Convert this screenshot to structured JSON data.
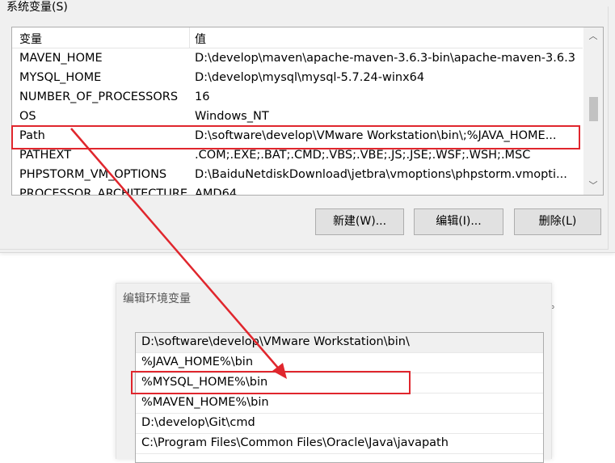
{
  "system_dialog": {
    "group_title": "系统变量(S)",
    "columns": {
      "name": "变量",
      "value": "值"
    },
    "rows": [
      {
        "name": "MAVEN_HOME",
        "value": "D:\\develop\\maven\\apache-maven-3.6.3-bin\\apache-maven-3.6.3"
      },
      {
        "name": "MYSQL_HOME",
        "value": "D:\\develop\\mysql\\mysql-5.7.24-winx64"
      },
      {
        "name": "NUMBER_OF_PROCESSORS",
        "value": "16"
      },
      {
        "name": "OS",
        "value": "Windows_NT"
      },
      {
        "name": "Path",
        "value": "D:\\software\\develop\\VMware Workstation\\bin\\;%JAVA_HOME..."
      },
      {
        "name": "PATHEXT",
        "value": ".COM;.EXE;.BAT;.CMD;.VBS;.VBE;.JS;.JSE;.WSF;.WSH;.MSC"
      },
      {
        "name": "PHPSTORM_VM_OPTIONS",
        "value": "D:\\BaiduNetdiskDownload\\jetbra\\vmoptions\\phpstorm.vmopti..."
      },
      {
        "name": "PROCESSOR_ARCHITECTURE",
        "value": "AMD64"
      }
    ],
    "buttons": {
      "new": "新建(W)...",
      "edit": "编辑(I)...",
      "delete": "删除(L)"
    },
    "scroll_up_glyph": "︿",
    "scroll_down_glyph": "﹀"
  },
  "edit_dialog": {
    "title": "编辑环境变量",
    "entries": [
      "D:\\software\\develop\\VMware Workstation\\bin\\",
      "%JAVA_HOME%\\bin",
      "%MYSQL_HOME%\\bin",
      "%MAVEN_HOME%\\bin",
      "D:\\develop\\Git\\cmd",
      "C:\\Program Files\\Common Files\\Oracle\\Java\\javapath",
      ""
    ],
    "background_fragment": "。"
  },
  "colors": {
    "annotation": "#e0262d",
    "dialog_bg": "#f0f0f0",
    "button_bg": "#e1e1e1"
  }
}
